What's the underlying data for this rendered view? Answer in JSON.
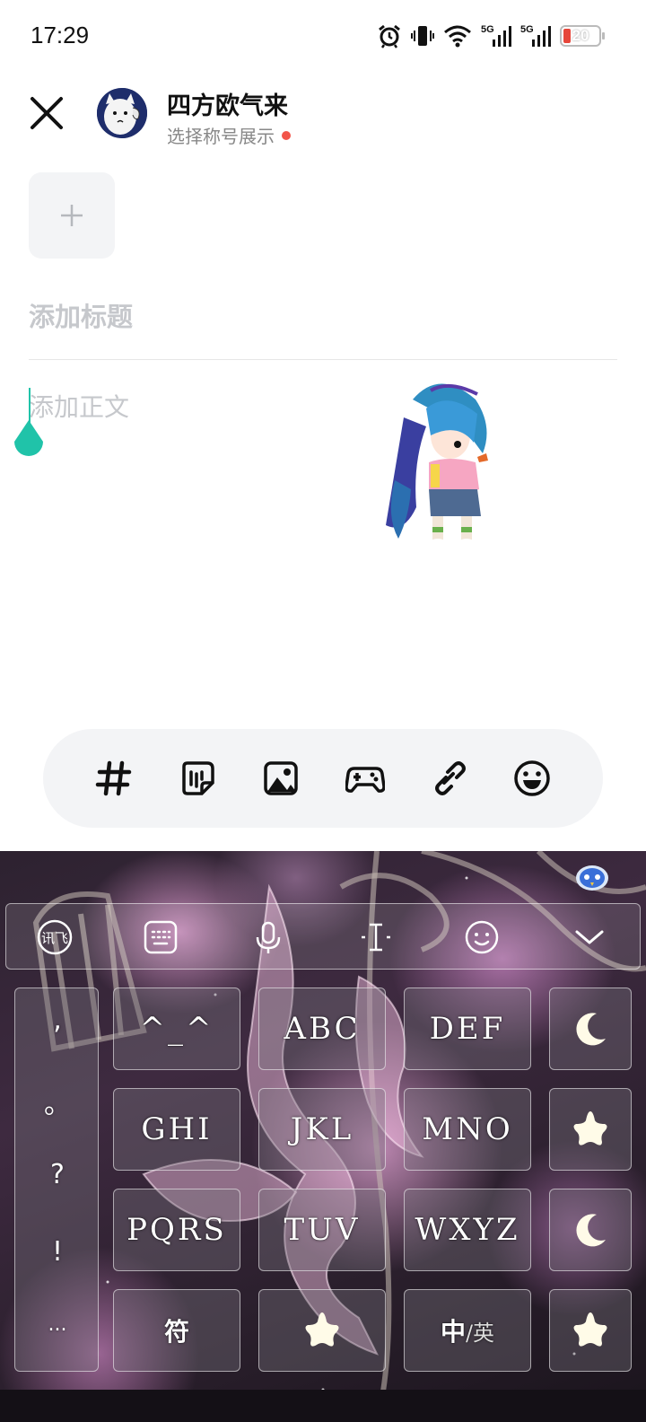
{
  "status_bar": {
    "time": "17:29",
    "icons": [
      "alarm-icon",
      "vibrate-icon",
      "wifi-icon",
      "signal-5g-icon",
      "signal-5g-icon"
    ],
    "network_labels": [
      "5G",
      "5G"
    ],
    "battery_level": "20",
    "battery_color": "#e6463a"
  },
  "header": {
    "close_icon": "close-icon",
    "user_name": "四方欧气来",
    "title_select_label": "选择称号展示",
    "notify_dot_color": "#f2554a"
  },
  "editor": {
    "add_image_icon": "plus-icon",
    "title_placeholder": "添加标题",
    "body_placeholder": "添加正文",
    "caret_color": "#20c3a9"
  },
  "toolbar": {
    "items": [
      "hashtag-icon",
      "sticker-icon",
      "image-icon",
      "game-icon",
      "link-icon",
      "emoji-icon"
    ]
  },
  "keyboard": {
    "toolbar_icons": [
      "ifly-logo-icon",
      "keyboard-icon",
      "microphone-icon",
      "cursor-icon",
      "smiley-icon",
      "collapse-icon"
    ],
    "ifly_label": "讯飞",
    "punctuation": [
      ",",
      "。",
      "?",
      "!",
      "..."
    ],
    "keys_row1": [
      "^_^",
      "ABC",
      "DEF"
    ],
    "keys_row2": [
      "GHI",
      "JKL",
      "MNO"
    ],
    "keys_row3": [
      "PQRS",
      "TUV",
      "WXYZ"
    ],
    "symbol_key": "符",
    "lang_key_main": "中",
    "lang_key_sep": "/",
    "lang_key_alt": "英",
    "side_keys": [
      "moon-icon",
      "star-icon",
      "moon-icon",
      "star-icon"
    ],
    "space_key_icon": "star-icon"
  }
}
